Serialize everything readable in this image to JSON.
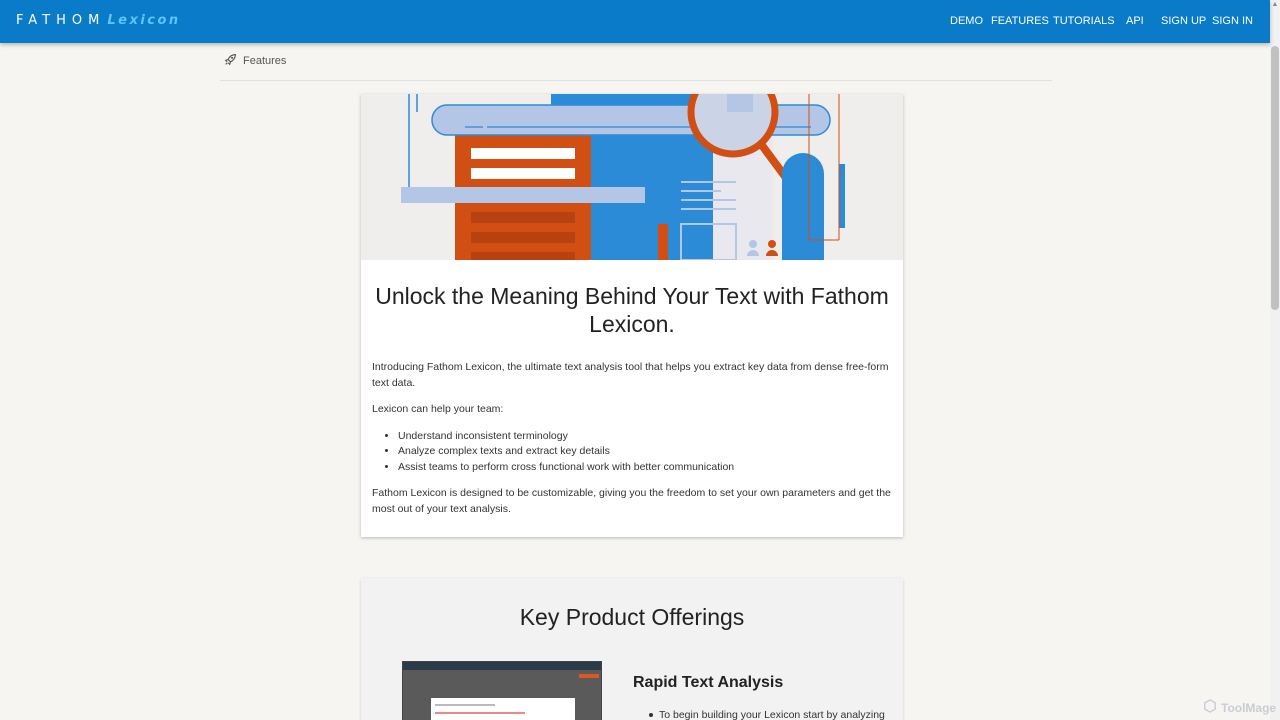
{
  "header": {
    "brand_main": "FATHOM",
    "brand_sub": "Lexicon",
    "nav": [
      "DEMO",
      "FEATURES",
      "TUTORIALS",
      "API",
      "SIGN UP",
      "SIGN IN"
    ]
  },
  "breadcrumb": {
    "label": "Features",
    "icon": "rocket-icon"
  },
  "intro_card": {
    "title": "Unlock the Meaning Behind Your Text with Fathom Lexicon.",
    "paragraph1": "Introducing Fathom Lexicon, the ultimate text analysis tool that helps you extract key data from dense free-form text data.",
    "paragraph2": "Lexicon can help your team:",
    "bullets": [
      "Understand inconsistent terminology",
      "Analyze complex texts and extract key details",
      "Assist teams to perform cross functional work with better communication"
    ],
    "paragraph3": "Fathom Lexicon is designed to be customizable, giving you the freedom to set your own parameters and get the most out of your text analysis."
  },
  "offerings": {
    "title": "Key Product Offerings",
    "feature_title": "Rapid Text Analysis",
    "feature_bullet": "To begin building your Lexicon start by analyzing"
  },
  "watermark": "ToolMage",
  "colors": {
    "nav_bg": "#0a7bc9",
    "brand_accent": "#5fc4ff",
    "hero_orange": "#d24f14",
    "hero_blue": "#2b8bd6",
    "hero_light_blue": "#b4c6e6"
  }
}
